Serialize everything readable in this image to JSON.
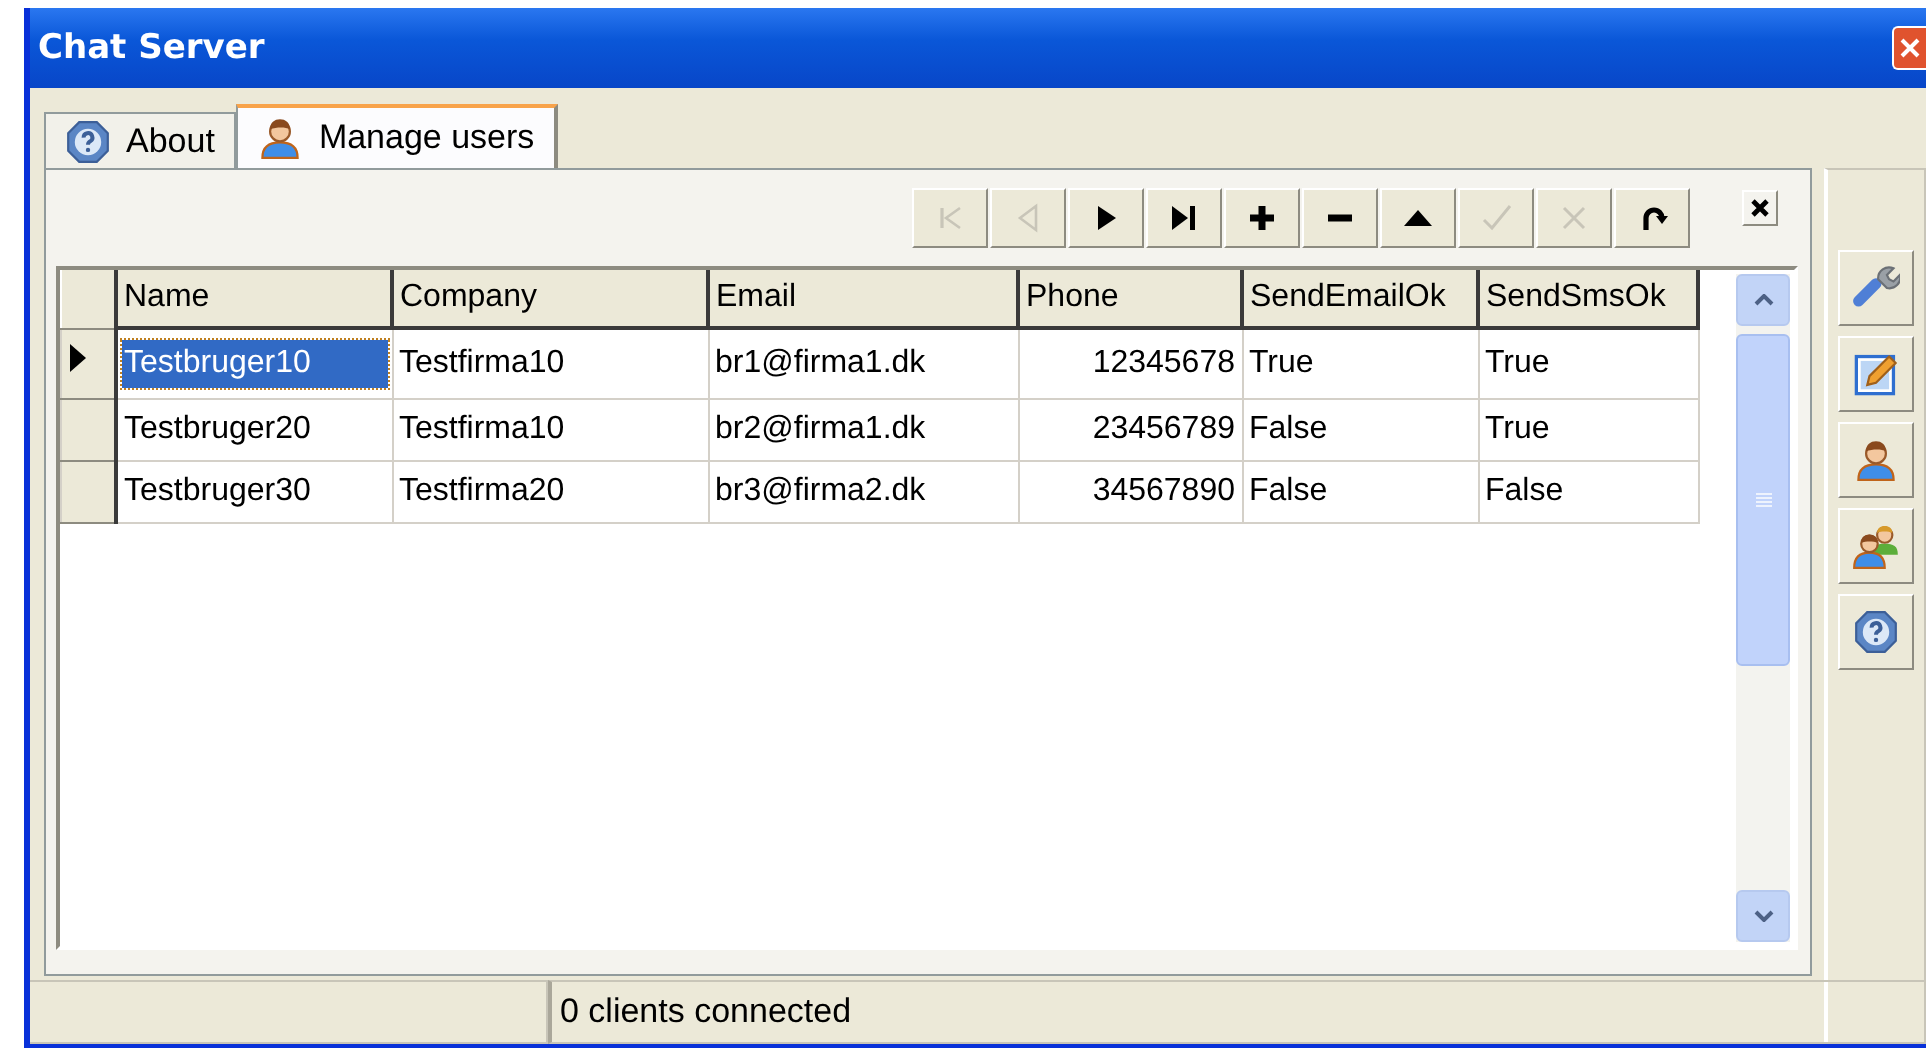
{
  "window": {
    "title": "Chat Server"
  },
  "tabs": [
    {
      "label": "About",
      "kind": "help",
      "selected": false
    },
    {
      "label": "Manage users",
      "kind": "user",
      "selected": true
    }
  ],
  "toolbar": [
    {
      "kind": "first",
      "disabled": true
    },
    {
      "kind": "prev",
      "disabled": true
    },
    {
      "kind": "next",
      "disabled": false
    },
    {
      "kind": "last",
      "disabled": false
    },
    {
      "kind": "add",
      "disabled": false
    },
    {
      "kind": "remove",
      "disabled": false
    },
    {
      "kind": "up",
      "disabled": false
    },
    {
      "kind": "apply",
      "disabled": true
    },
    {
      "kind": "cancel",
      "disabled": true
    },
    {
      "kind": "refresh",
      "disabled": false
    }
  ],
  "table": {
    "columns": [
      "Name",
      "Company",
      "Email",
      "Phone",
      "SendEmailOk",
      "SendSmsOk"
    ],
    "rows": [
      {
        "selected": true,
        "cells": [
          "Testbruger10",
          "Testfirma10",
          "br1@firma1.dk",
          "12345678",
          "True",
          "True"
        ]
      },
      {
        "selected": false,
        "cells": [
          "Testbruger20",
          "Testfirma10",
          "br2@firma1.dk",
          "23456789",
          "False",
          "True"
        ]
      },
      {
        "selected": false,
        "cells": [
          "Testbruger30",
          "Testfirma20",
          "br3@firma2.dk",
          "34567890",
          "False",
          "False"
        ]
      }
    ]
  },
  "side_buttons": [
    {
      "kind": "wrench"
    },
    {
      "kind": "edit"
    },
    {
      "kind": "user"
    },
    {
      "kind": "users"
    },
    {
      "kind": "help"
    }
  ],
  "status_bar": {
    "panel_2": "0 clients connected"
  }
}
